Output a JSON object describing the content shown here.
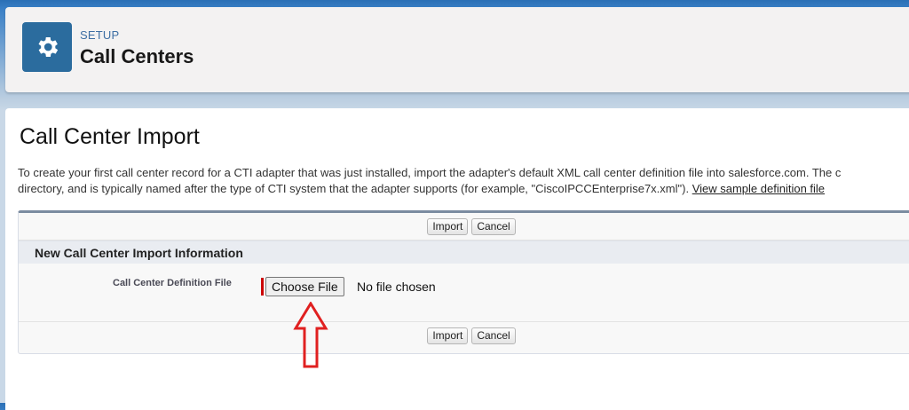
{
  "header": {
    "icon": "gear-icon",
    "setup_label": "SETUP",
    "title": "Call Centers"
  },
  "content": {
    "title": "Call Center Import",
    "description_line1": "To create your first call center record for a CTI adapter that was just installed, import the adapter's default XML call center definition file into salesforce.com. The c",
    "description_line2": "directory, and is typically named after the type of CTI system that the adapter supports (for example, \"CiscoIPCCEnterprise7x.xml\"). ",
    "sample_link": "View sample definition file"
  },
  "form": {
    "import_label": "Import",
    "cancel_label": "Cancel",
    "section_title": "New Call Center Import Information",
    "field_label": "Call Center Definition File",
    "choose_file_label": "Choose File",
    "file_status": "No file chosen"
  },
  "colors": {
    "icon_bg": "#2b6c9e",
    "required": "#cc0000",
    "annotation_arrow": "#e02020"
  }
}
